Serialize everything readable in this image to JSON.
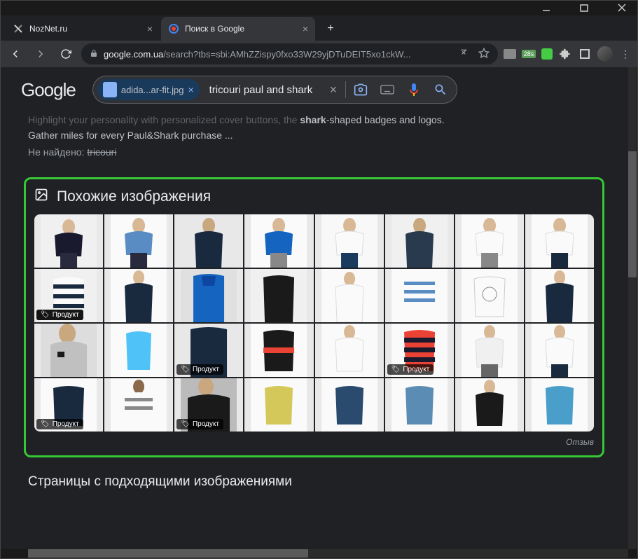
{
  "window": {
    "tabs": [
      {
        "title": "NozNet.ru",
        "active": false
      },
      {
        "title": "Поиск в Google",
        "active": true
      }
    ]
  },
  "omnibox": {
    "domain": "google.com.ua",
    "path": "/search?tbs=sbi:AMhZZispy0fxo33W29yjDTuDEIT5xo1ckW..."
  },
  "ext_badge": "28s",
  "google": {
    "logo": "Google",
    "chip_label": "adida...ar-fit.jpg",
    "query": "tricouri paul and shark"
  },
  "snippet": {
    "line1_a": "Highlight your personality with personalized cover buttons, the ",
    "line1_b": "shark",
    "line1_c": "-shaped badges and logos.",
    "line2": "Gather miles for every Paul&Shark purchase ...",
    "not_found_label": "Не найдено:",
    "not_found_term": "tricouri"
  },
  "similar": {
    "title": "Похожие изображения",
    "product_tag": "Продукт",
    "feedback": "Отзыв"
  },
  "pages_title": "Страницы с подходящими изображениями"
}
